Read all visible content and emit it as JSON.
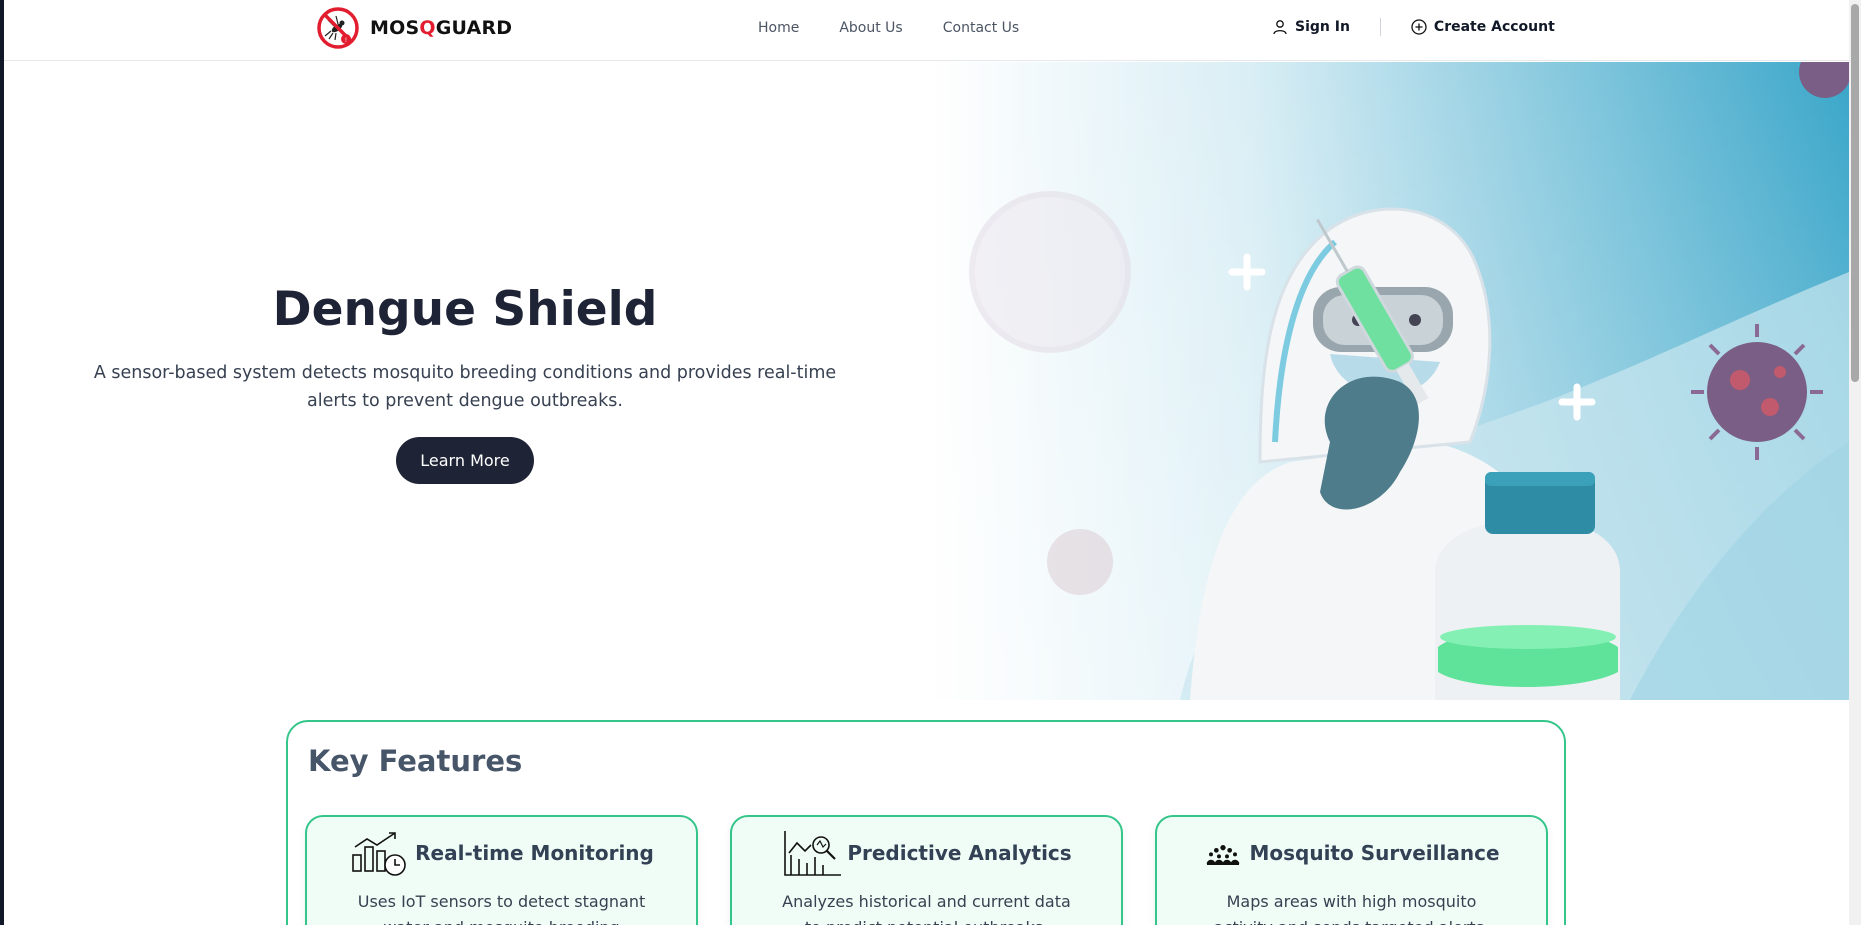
{
  "header": {
    "logo_prefix": "MOS",
    "logo_q": "Q",
    "logo_suffix": "GUARD",
    "nav": [
      "Home",
      "About Us",
      "Contact Us"
    ],
    "sign_in": "Sign In",
    "create_account": "Create Account"
  },
  "hero": {
    "title": "Dengue Shield",
    "description": "A sensor-based system detects mosquito breeding conditions and provides real-time alerts to prevent dengue outbreaks.",
    "cta": "Learn More"
  },
  "features": {
    "title": "Key Features",
    "items": [
      {
        "icon": "chart-monitor-icon",
        "title": "Real-time Monitoring",
        "desc": "Uses IoT sensors to detect stagnant water and mosquito breeding patterns."
      },
      {
        "icon": "analytics-magnifier-icon",
        "title": "Predictive Analytics",
        "desc": "Analyzes historical and current data to predict potential outbreaks."
      },
      {
        "icon": "crowd-icon",
        "title": "Mosquito Surveillance",
        "desc": "Maps areas with high mosquito activity and sends targeted alerts."
      }
    ]
  },
  "colors": {
    "accent": "#34c58a",
    "dark": "#1e2335",
    "logo_red": "#e11d2f"
  }
}
